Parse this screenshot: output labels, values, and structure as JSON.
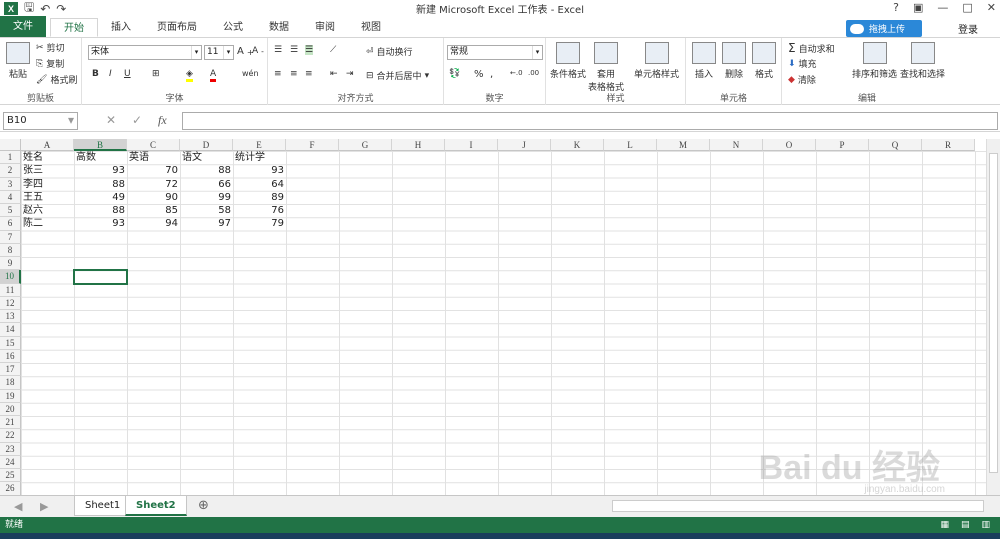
{
  "window": {
    "title": "新建 Microsoft Excel 工作表 - Excel",
    "controls": [
      "?",
      "▣",
      "—",
      "□",
      "✕"
    ]
  },
  "ribbon_tabs": [
    "文件",
    "开始",
    "插入",
    "页面布局",
    "公式",
    "数据",
    "审阅",
    "视图"
  ],
  "upload_label": "拖拽上传",
  "login_label": "登录",
  "clipboard": {
    "paste": "粘贴",
    "cut": "剪切",
    "copy": "复制",
    "format_painter": "格式刷",
    "label": "剪贴板"
  },
  "font": {
    "name": "宋体",
    "size": "11",
    "label": "字体"
  },
  "alignment": {
    "wrap": "自动换行",
    "merge": "合并后居中",
    "label": "对齐方式"
  },
  "number": {
    "format": "常规",
    "percent": "%",
    "label": "数字"
  },
  "styles": {
    "conditional": "条件格式",
    "table": "套用\n表格格式",
    "cell": "单元格样式",
    "label": "样式"
  },
  "cells_group": {
    "insert": "插入",
    "delete": "删除",
    "format": "格式",
    "label": "单元格"
  },
  "editing": {
    "autosum": "自动求和",
    "fill": "填充",
    "clear": "清除",
    "sort": "排序和筛选",
    "find": "查找和选择",
    "label": "编辑"
  },
  "formula_bar": {
    "namebox": "B10",
    "fx": "fx",
    "formula": ""
  },
  "columns": [
    "A",
    "B",
    "C",
    "D",
    "E",
    "F",
    "G",
    "H",
    "I",
    "J",
    "K",
    "L",
    "M",
    "N",
    "O",
    "P",
    "Q",
    "R"
  ],
  "rows": [
    "1",
    "2",
    "3",
    "4",
    "5",
    "6",
    "7",
    "8",
    "9",
    "10",
    "11",
    "12",
    "13",
    "14",
    "15",
    "16",
    "17",
    "18",
    "19",
    "20",
    "21",
    "22",
    "23",
    "24",
    "25",
    "26"
  ],
  "table": {
    "header": [
      "姓名",
      "高数",
      "英语",
      "语文",
      "统计学"
    ],
    "body": [
      [
        "张三",
        "93",
        "70",
        "88",
        "93"
      ],
      [
        "李四",
        "88",
        "72",
        "66",
        "64"
      ],
      [
        "王五",
        "49",
        "90",
        "99",
        "89"
      ],
      [
        "赵六",
        "88",
        "85",
        "58",
        "76"
      ],
      [
        "陈二",
        "93",
        "94",
        "97",
        "79"
      ]
    ]
  },
  "sheets": [
    "Sheet1",
    "Sheet2"
  ],
  "status": {
    "ready": "就绪"
  },
  "watermark": {
    "main": "Bai du 经验",
    "sub": "jingyan.baidu.com"
  }
}
